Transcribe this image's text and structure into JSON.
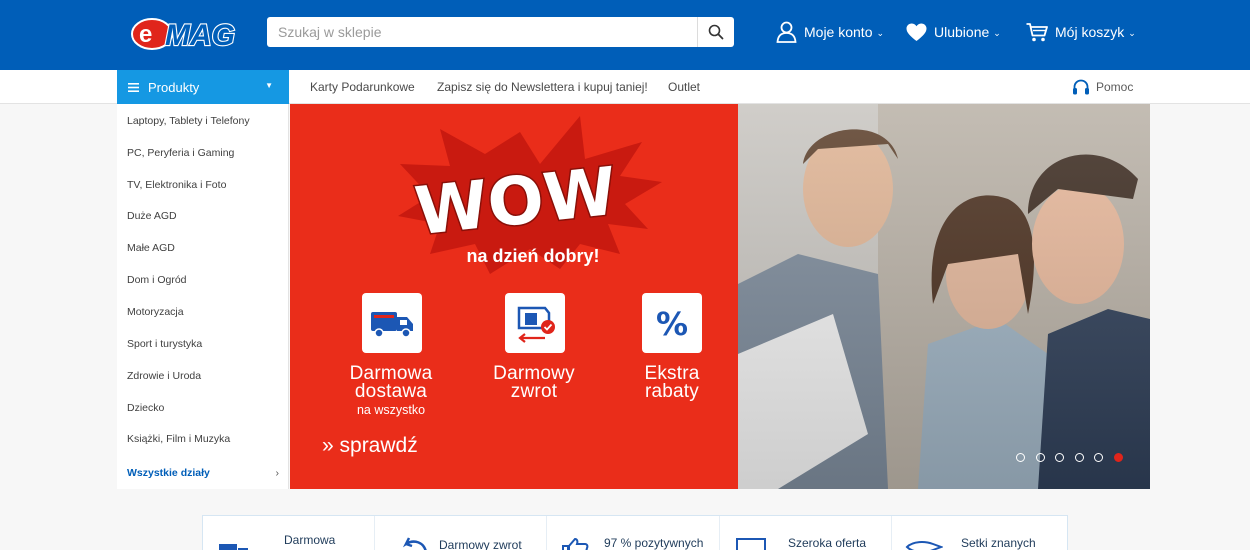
{
  "header": {
    "logo_text": "eMAG",
    "search_placeholder": "Szukaj w sklepie",
    "account_label": "Moje konto",
    "favorites_label": "Ulubione",
    "cart_label": "Mój koszyk",
    "chevron": "⌄",
    "brand_color": "#005eb8"
  },
  "nav": {
    "products_label": "Produkty",
    "links": [
      "Karty Podarunkowe",
      "Zapisz się do Newslettera i kupuj taniej!",
      "Outlet"
    ],
    "help_label": "Pomoc",
    "accent_color": "#1598e3"
  },
  "sidebar": {
    "items": [
      "Laptopy, Tablety i Telefony",
      "PC, Peryferia i Gaming",
      "TV, Elektronika i Foto",
      "Duże AGD",
      "Małe AGD",
      "Dom i Ogród",
      "Motoryzacja",
      "Sport i turystyka",
      "Zdrowie i Uroda",
      "Dziecko",
      "Książki, Film i Muzyka"
    ],
    "all_label": "Wszystkie działy",
    "all_arrow": "›"
  },
  "banner": {
    "wow": "WOW",
    "tagline": "na dzień dobry!",
    "tiles": [
      {
        "icon": "truck-icon",
        "line1": "Darmowa",
        "line2": "dostawa",
        "sub": "na wszystko"
      },
      {
        "icon": "return-box-icon",
        "line1": "Darmowy",
        "line2": "zwrot",
        "sub": ""
      },
      {
        "icon": "percent-icon",
        "line1": "Ekstra",
        "line2": "rabaty",
        "sub": ""
      }
    ],
    "cta": "» sprawdź",
    "background_color": "#ea2d1a",
    "slide_count": 6,
    "active_slide": 6
  },
  "features": {
    "items": [
      "Darmowa",
      "Darmowy zwrot",
      "97 % pozytywnych",
      "Szeroka oferta",
      "Setki znanych"
    ]
  }
}
